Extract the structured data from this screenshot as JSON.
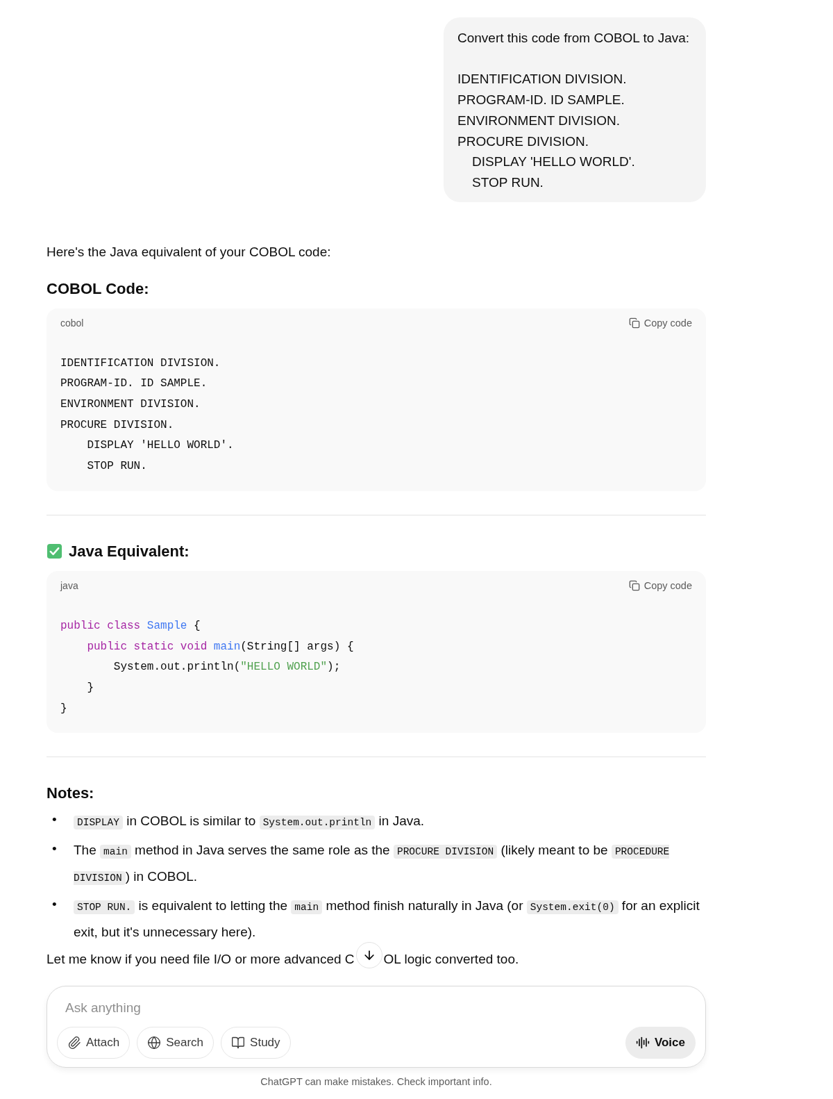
{
  "user_message": {
    "paragraphs": [
      {
        "lines": [
          "Convert this code from COBOL to Java:"
        ]
      },
      {
        "lines": [
          "IDENTIFICATION DIVISION.",
          "PROGRAM-ID. ID SAMPLE.",
          "ENVIRONMENT DIVISION.",
          "PROCURE DIVISION.",
          "    DISPLAY 'HELLO WORLD'.",
          "    STOP RUN."
        ]
      }
    ]
  },
  "assistant": {
    "intro": "Here's the Java equivalent of your COBOL code:",
    "sections": [
      {
        "heading": "COBOL Code:",
        "code": {
          "language": "cobol",
          "copy_label": "Copy code",
          "lines": [
            [
              {
                "kind": "plain",
                "text": "IDENTIFICATION DIVISION."
              }
            ],
            [
              {
                "kind": "plain",
                "text": "PROGRAM-ID. ID SAMPLE."
              }
            ],
            [
              {
                "kind": "plain",
                "text": "ENVIRONMENT DIVISION."
              }
            ],
            [
              {
                "kind": "plain",
                "text": "PROCURE DIVISION."
              }
            ],
            [
              {
                "kind": "plain",
                "text": "    DISPLAY 'HELLO WORLD'."
              }
            ],
            [
              {
                "kind": "plain",
                "text": "    STOP RUN."
              }
            ]
          ]
        }
      },
      {
        "heading": "Java Equivalent:",
        "check_icon": true,
        "code": {
          "language": "java",
          "copy_label": "Copy code",
          "lines": [
            [
              {
                "kind": "keyword",
                "text": "public class "
              },
              {
                "kind": "name",
                "text": "Sample"
              },
              {
                "kind": "plain",
                "text": " {"
              }
            ],
            [
              {
                "kind": "keyword",
                "text": "    public static void "
              },
              {
                "kind": "name",
                "text": "main"
              },
              {
                "kind": "plain",
                "text": "(String[] args) {"
              }
            ],
            [
              {
                "kind": "plain",
                "text": "        System.out.println("
              },
              {
                "kind": "string",
                "text": "\"HELLO WORLD\""
              },
              {
                "kind": "plain",
                "text": ");"
              }
            ],
            [
              {
                "kind": "plain",
                "text": "    }"
              }
            ],
            [
              {
                "kind": "plain",
                "text": "}"
              }
            ]
          ]
        }
      }
    ],
    "notes_heading": "Notes:",
    "notes": [
      {
        "marker": "•",
        "segments": [
          {
            "kind": "code",
            "text": "DISPLAY"
          },
          {
            "kind": "text",
            "text": " in COBOL is similar to "
          },
          {
            "kind": "code",
            "text": "System.out.println"
          },
          {
            "kind": "text",
            "text": " in Java."
          }
        ]
      },
      {
        "marker": "•",
        "segments": [
          {
            "kind": "text",
            "text": "The "
          },
          {
            "kind": "code",
            "text": "main"
          },
          {
            "kind": "text",
            "text": " method in Java serves the same role as the "
          },
          {
            "kind": "code",
            "text": "PROCURE DIVISION"
          },
          {
            "kind": "text",
            "text": " (likely meant to be "
          },
          {
            "kind": "code",
            "text": "PROCEDURE DIVISION"
          },
          {
            "kind": "text",
            "text": ") in COBOL."
          }
        ]
      },
      {
        "marker": "•",
        "segments": [
          {
            "kind": "code",
            "text": "STOP RUN."
          },
          {
            "kind": "text",
            "text": " is equivalent to letting the "
          },
          {
            "kind": "code",
            "text": "main"
          },
          {
            "kind": "text",
            "text": " method finish naturally in Java (or "
          },
          {
            "kind": "code",
            "text": "System.exit(0)"
          },
          {
            "kind": "text",
            "text": " for an explicit exit, but it's unnecessary here)."
          }
        ]
      }
    ],
    "closing_before": "Let me know if you need file I/O or more advanced C",
    "closing_after": "OL logic converted too."
  },
  "composer": {
    "placeholder": "Ask anything",
    "buttons": [
      {
        "kind": "attach",
        "label": "Attach"
      },
      {
        "kind": "search",
        "label": "Search"
      },
      {
        "kind": "study",
        "label": "Study"
      }
    ],
    "voice_label": "Voice"
  },
  "footer": "ChatGPT can make mistakes. Check important info."
}
